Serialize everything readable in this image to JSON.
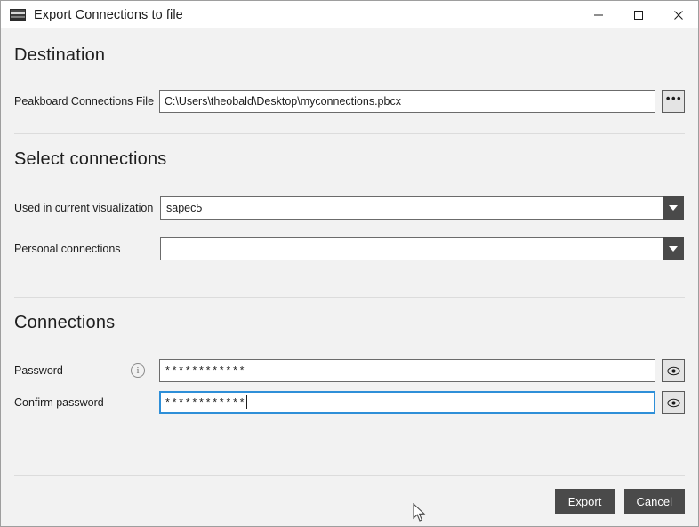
{
  "window": {
    "title": "Export Connections to file",
    "app_icon": "keyboard-app-icon",
    "controls": {
      "minimize": "minimize-icon",
      "maximize": "maximize-icon",
      "close": "close-icon"
    }
  },
  "destination": {
    "heading": "Destination",
    "file_label": "Peakboard Connections File",
    "file_value": "C:\\Users\\theobald\\Desktop\\myconnections.pbcx",
    "file_placeholder": "",
    "browse_label": "•••"
  },
  "select_connections": {
    "heading": "Select connections",
    "used_label": "Used in current visualization",
    "used_value": "sapec5",
    "used_options": [
      "sapec5"
    ],
    "personal_label": "Personal connections",
    "personal_value": "",
    "personal_options": []
  },
  "connections": {
    "heading": "Connections",
    "password_label": "Password",
    "password_info": "info-icon",
    "password_value": "************",
    "confirm_label": "Confirm password",
    "confirm_value": "************",
    "reveal_icon": "eye-icon"
  },
  "footer": {
    "export_label": "Export",
    "cancel_label": "Cancel"
  },
  "colors": {
    "titlebar_bg": "#ffffff",
    "body_bg": "#f2f2f2",
    "accent_dark": "#4a4a4a",
    "focus_border": "#2e8fd8",
    "input_border": "#6b6b6b",
    "divider": "#dcdcdc"
  }
}
